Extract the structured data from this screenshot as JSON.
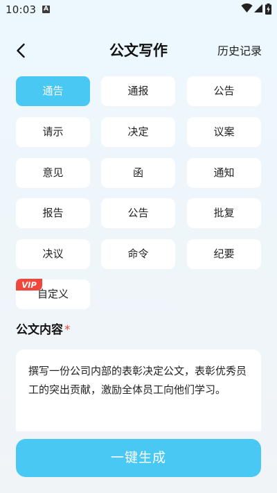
{
  "status_bar": {
    "time": "10:03",
    "notification_glyph": "A",
    "icons": [
      "wifi-icon",
      "signal-icon",
      "battery-charging-icon"
    ]
  },
  "header": {
    "back_icon": "chevron-left-icon",
    "title": "公文写作",
    "history_label": "历史记录"
  },
  "doc_types": [
    {
      "label": "通告",
      "selected": true
    },
    {
      "label": "通报",
      "selected": false
    },
    {
      "label": "公告",
      "selected": false
    },
    {
      "label": "请示",
      "selected": false
    },
    {
      "label": "决定",
      "selected": false
    },
    {
      "label": "议案",
      "selected": false
    },
    {
      "label": "意见",
      "selected": false
    },
    {
      "label": "函",
      "selected": false
    },
    {
      "label": "通知",
      "selected": false
    },
    {
      "label": "报告",
      "selected": false
    },
    {
      "label": "公告",
      "selected": false
    },
    {
      "label": "批复",
      "selected": false
    },
    {
      "label": "决议",
      "selected": false
    },
    {
      "label": "命令",
      "selected": false
    },
    {
      "label": "纪要",
      "selected": false
    },
    {
      "label": "自定义",
      "selected": false,
      "vip": true
    }
  ],
  "vip_badge": "VIP",
  "content": {
    "label": "公文内容",
    "required_mark": "*",
    "value": "撰写一份公司内部的表彰决定公文，表彰优秀员工的突出贡献，激励全体员工向他们学习。"
  },
  "generate_button": "一键生成",
  "colors": {
    "accent": "#49c8f3",
    "required": "#e8483f",
    "vip_badge": "#f0473d"
  }
}
